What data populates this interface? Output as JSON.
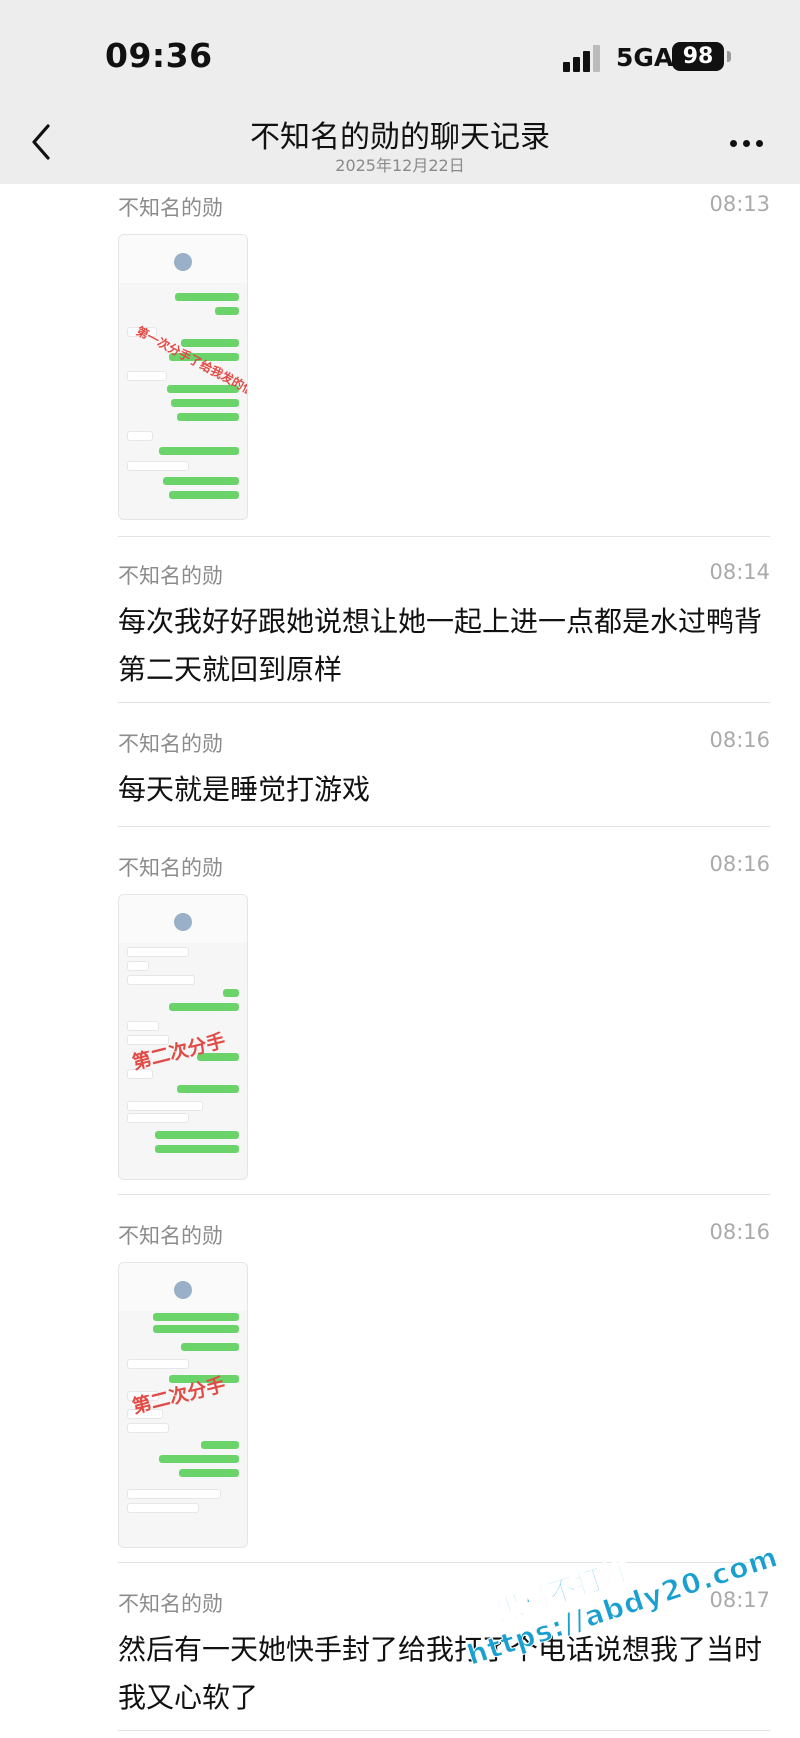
{
  "status_bar": {
    "time": "09:36",
    "network": "5GA",
    "battery": "98"
  },
  "header": {
    "title": "不知名的勋的聊天记录",
    "date": "2025年12月22日",
    "back_icon": "chevron-left-icon",
    "more_icon": "more-horizontal-icon"
  },
  "messages": [
    {
      "sender": "不知名的勋",
      "time": "08:13",
      "type": "image",
      "stamp": "第一次分手了给我发的信息"
    },
    {
      "sender": "不知名的勋",
      "time": "08:14",
      "type": "text",
      "text": "每次我好好跟她说想让她一起上进一点都是水过鸭背第二天就回到原样"
    },
    {
      "sender": "不知名的勋",
      "time": "08:16",
      "type": "text",
      "text": "每天就是睡觉打游戏"
    },
    {
      "sender": "不知名的勋",
      "time": "08:16",
      "type": "image",
      "stamp": "第二次分手"
    },
    {
      "sender": "不知名的勋",
      "time": "08:16",
      "type": "image",
      "stamp": "第二次分手"
    },
    {
      "sender": "不知名的勋",
      "time": "08:17",
      "type": "text",
      "text": "然后有一天她快手封了给我打了个电话说想我了当时我又心软了"
    }
  ],
  "watermark": {
    "line1": "黑料不打烊",
    "line2": "https://abdy20.com"
  },
  "colors": {
    "header_bg": "#ededed",
    "stamp_red": "#e24a45",
    "bubble_green": "#6ad46a",
    "watermark_blue": "#1aa8d8"
  }
}
